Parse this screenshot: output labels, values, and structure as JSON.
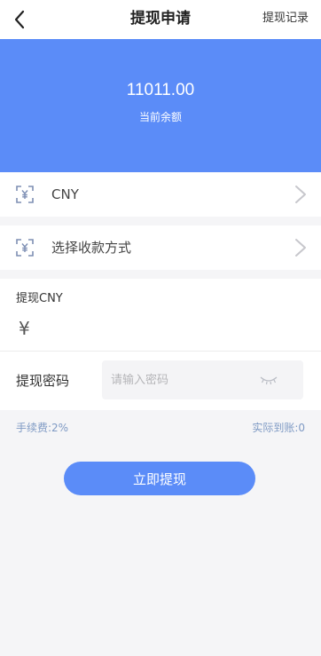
{
  "header": {
    "title": "提现申请",
    "right_link": "提现记录"
  },
  "balance": {
    "amount": "11011.00",
    "label": "当前余额"
  },
  "currency_row": {
    "label": "CNY"
  },
  "payment_row": {
    "label": "选择收款方式"
  },
  "amount_section": {
    "title": "提现CNY",
    "currency_symbol": "¥",
    "value": ""
  },
  "password_section": {
    "label": "提现密码",
    "placeholder": "请输入密码"
  },
  "fee": {
    "fee_text": "手续费:2%",
    "received_text": "实际到账:0"
  },
  "submit": {
    "label": "立即提现"
  },
  "colors": {
    "primary": "#5b8cf8",
    "muted_blue": "#7f9ac4",
    "background": "#f5f5f7"
  },
  "icons": {
    "back": "chevron-left-icon",
    "row_icon": "scan-yuan-icon",
    "row_arrow": "chevron-right-icon",
    "eye": "eye-closed-icon"
  }
}
